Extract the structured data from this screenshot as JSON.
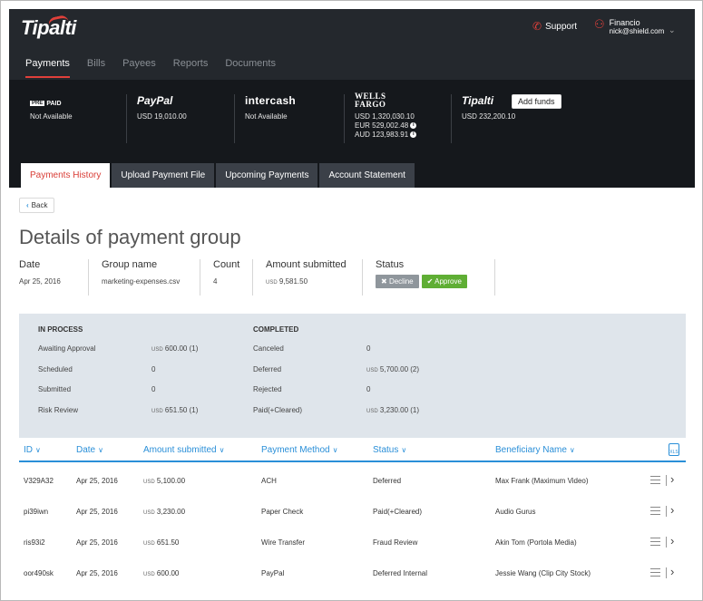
{
  "header": {
    "logo": "Tipalti",
    "support_label": "Support",
    "user_name": "Financio",
    "user_email": "nick@shield.com",
    "nav": [
      {
        "label": "Payments",
        "active": true
      },
      {
        "label": "Bills",
        "active": false
      },
      {
        "label": "Payees",
        "active": false
      },
      {
        "label": "Reports",
        "active": false
      },
      {
        "label": "Documents",
        "active": false
      }
    ]
  },
  "balances": {
    "prepaid": {
      "box": "PRE",
      "brand": "PAID",
      "amount": "Not Available"
    },
    "paypal": {
      "brand": "PayPal",
      "amount": "USD 19,010.00"
    },
    "intercash": {
      "brand": "intercash",
      "amount": "Not Available"
    },
    "wells": {
      "brand_line1": "WELLS",
      "brand_line2": "FARGO",
      "amounts": [
        "USD 1,320,030.10",
        "EUR 529,002.48",
        "AUD 123,983.91"
      ]
    },
    "tipalti": {
      "brand": "Tipalti",
      "amount": "USD 232,200.10",
      "add_funds_label": "Add funds"
    }
  },
  "tabs": [
    {
      "label": "Payments History",
      "active": true
    },
    {
      "label": "Upload Payment File",
      "active": false
    },
    {
      "label": "Upcoming Payments",
      "active": false
    },
    {
      "label": "Account Statement",
      "active": false
    }
  ],
  "back_label": "Back",
  "page_title": "Details of payment group",
  "summary": {
    "date_label": "Date",
    "date_value": "Apr 25, 2016",
    "group_label": "Group name",
    "group_value": "marketing-expenses.csv",
    "count_label": "Count",
    "count_value": "4",
    "amount_label": "Amount submitted",
    "amount_currency": "USD",
    "amount_value": "9,581.50",
    "status_label": "Status",
    "decline_label": "Decline",
    "approve_label": "Approve"
  },
  "status_panel": {
    "in_process_heading": "IN PROCESS",
    "completed_heading": "COMPLETED",
    "in_process": [
      {
        "label": "Awaiting Approval",
        "currency": "USD",
        "value": "600.00 (1)"
      },
      {
        "label": "Scheduled",
        "currency": "",
        "value": "0"
      },
      {
        "label": "Submitted",
        "currency": "",
        "value": "0"
      },
      {
        "label": "Risk Review",
        "currency": "USD",
        "value": "651.50 (1)"
      }
    ],
    "completed": [
      {
        "label": "Canceled",
        "currency": "",
        "value": "0"
      },
      {
        "label": "Deferred",
        "currency": "USD",
        "value": "5,700.00 (2)"
      },
      {
        "label": "Rejected",
        "currency": "",
        "value": "0"
      },
      {
        "label": "Paid(+Cleared)",
        "currency": "USD",
        "value": "3,230.00 (1)"
      }
    ]
  },
  "table": {
    "columns": [
      "ID",
      "Date",
      "Amount submitted",
      "Payment Method",
      "Status",
      "Beneficiary Name"
    ],
    "export_label": "XLS",
    "rows": [
      {
        "id": "V329A32",
        "date": "Apr 25, 2016",
        "currency": "USD",
        "amount": "5,100.00",
        "method": "ACH",
        "status": "Deferred",
        "beneficiary": "Max Frank (Maximum Video)"
      },
      {
        "id": "pi39iwn",
        "date": "Apr 25, 2016",
        "currency": "USD",
        "amount": "3,230.00",
        "method": "Paper Check",
        "status": "Paid(+Cleared)",
        "beneficiary": "Audio Gurus"
      },
      {
        "id": "ris93i2",
        "date": "Apr 25, 2016",
        "currency": "USD",
        "amount": "651.50",
        "method": "Wire Transfer",
        "status": "Fraud Review",
        "beneficiary": "Akin Tom (Portola Media)"
      },
      {
        "id": "oor490sk",
        "date": "Apr 25, 2016",
        "currency": "USD",
        "amount": "600.00",
        "method": "PayPal",
        "status": "Deferred Internal",
        "beneficiary": "Jessie Wang (Clip City Stock)"
      }
    ]
  },
  "colors": {
    "accent_red": "#e0403a",
    "accent_blue": "#2a8fd8",
    "approve_green": "#5fae34",
    "header_bg": "#24282d"
  }
}
